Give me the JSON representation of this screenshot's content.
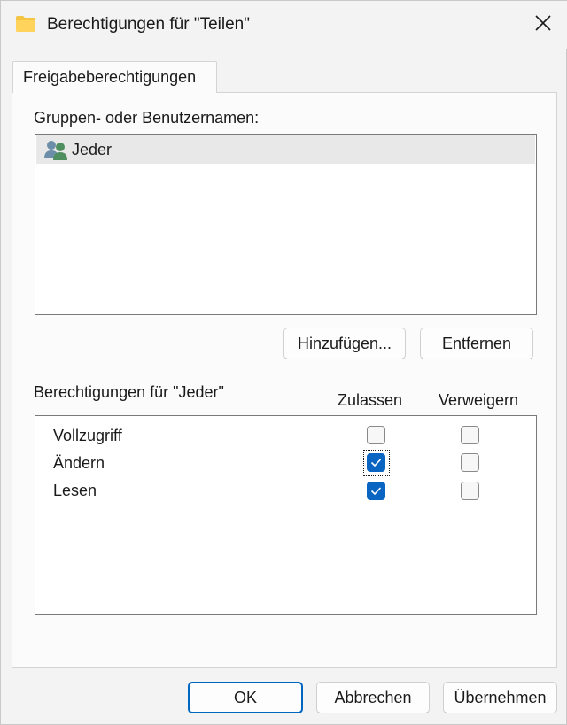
{
  "window": {
    "title": "Berechtigungen für \"Teilen\"",
    "folder_icon": "folder-icon",
    "close_icon": "close-icon"
  },
  "tab": {
    "label": "Freigabeberechtigungen"
  },
  "users": {
    "heading": "Gruppen- oder Benutzernamen:",
    "items": [
      {
        "name": "Jeder",
        "icon": "user-group-icon",
        "selected": true
      }
    ],
    "add_button": "Hinzufügen...",
    "remove_button": "Entfernen"
  },
  "permissions": {
    "heading": "Berechtigungen für \"Jeder\"",
    "allow_column": "Zulassen",
    "deny_column": "Verweigern",
    "rows": [
      {
        "label": "Vollzugriff",
        "allow": false,
        "deny": false
      },
      {
        "label": "Ändern",
        "allow": true,
        "deny": false,
        "focused": true
      },
      {
        "label": "Lesen",
        "allow": true,
        "deny": false
      }
    ]
  },
  "footer": {
    "ok_label": "OK",
    "cancel_label": "Abbrechen",
    "apply_label": "Übernehmen"
  },
  "colors": {
    "accent": "#0a64c2",
    "folder": "#f4c542"
  }
}
